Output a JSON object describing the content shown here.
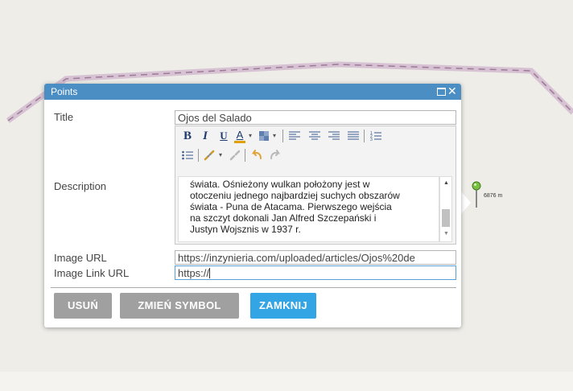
{
  "popup": {
    "title": "Points",
    "fields": {
      "title_label": "Title",
      "title_value": "Ojos del Salado",
      "description_label": "Description",
      "description_lines": [
        "świata. Ośnieżony wulkan położony jest w",
        "otoczeniu jednego najbardziej suchych obszarów",
        "świata - Puna de Atacama. Pierwszego wejścia",
        "na szczyt dokonali Jan Alfred Szczepański i",
        "Justyn Wojsznis w 1937 r."
      ],
      "image_url_label": "Image URL",
      "image_url_value": "https://inzynieria.com/uploaded/articles/Ojos%20de",
      "image_link_label": "Image Link URL",
      "image_link_value": "https://"
    },
    "toolbar": {
      "bold": "B",
      "italic": "I",
      "underline": "U",
      "font_color": "A",
      "font_color_accent": "#e0a000"
    },
    "buttons": {
      "delete": "USUŃ",
      "change_symbol": "ZMIEŃ SYMBOL",
      "close": "ZAMKNIJ"
    },
    "colors": {
      "title_bar": "#4a8ec4",
      "primary_button": "#33a5e5",
      "secondary_button": "#a0a0a0"
    }
  },
  "map": {
    "marker_label": "6876 m",
    "route_color": "#c9a8c2"
  }
}
